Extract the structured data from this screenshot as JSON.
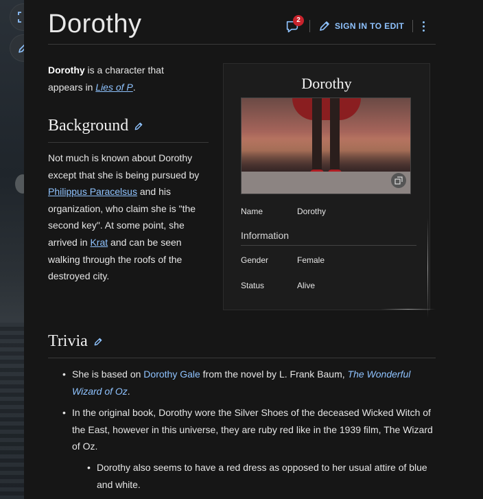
{
  "page": {
    "title": "Dorothy",
    "comment_count": "2",
    "sign_in_label": "SIGN IN TO EDIT"
  },
  "intro": {
    "bold": "Dorothy",
    "text_after_bold": " is a character that appears in ",
    "link": "Lies of P",
    "period": "."
  },
  "background": {
    "heading": "Background",
    "text_1": "Not much is known about Dorothy except that she is being pursued by ",
    "link_1": "Philippus Paracelsus",
    "text_2": " and his organization, who claim she is \"the second key\". At some point, she arrived in ",
    "link_2": "Krat",
    "text_3": " and can be seen walking through the roofs of the destroyed city."
  },
  "infobox": {
    "title": "Dorothy",
    "name_label": "Name",
    "name_value": "Dorothy",
    "section": "Information",
    "gender_label": "Gender",
    "gender_value": "Female",
    "status_label": "Status",
    "status_value": "Alive"
  },
  "trivia": {
    "heading": "Trivia",
    "item1_text_1": "She is based on ",
    "item1_link": "Dorothy Gale",
    "item1_text_2": " from the novel by L. Frank Baum, ",
    "item1_link_italic": "The Wonderful Wizard of Oz",
    "item1_text_3": ".",
    "item2_text": "In the original book, Dorothy wore the Silver Shoes of the deceased Wicked Witch of the East, however in this universe, they are ruby red like in the 1939 film, The Wizard of Oz.",
    "sub_item_text": "Dorothy also seems to have a red dress as opposed to her usual attire of blue and white."
  },
  "colors": {
    "link": "#8fc3ff",
    "badge": "#c8232c",
    "background": "#161616"
  },
  "icons": [
    "fullscreen-icon",
    "pencil-icon",
    "comment-icon",
    "kebab-menu-icon",
    "expand-image-icon"
  ]
}
